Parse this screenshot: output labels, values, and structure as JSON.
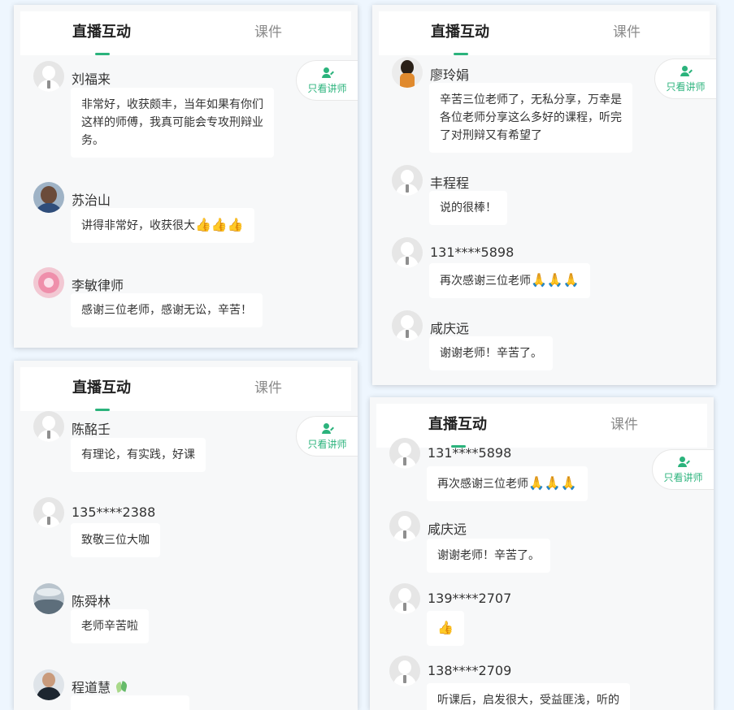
{
  "tabs": {
    "live": "直播互动",
    "courseware": "课件"
  },
  "only_teacher_label": "只看讲师",
  "panels": {
    "p1": {
      "m1": {
        "name": "刘福来",
        "lines": [
          "非常好，收获颇丰，当年如果有你们",
          "这样的师傅，我真可能会专攻刑辩业",
          "务。"
        ]
      },
      "m2": {
        "name": "苏治山",
        "text": "讲得非常好，收获很大",
        "emoji": "👍👍👍"
      },
      "m3": {
        "name": "李敏律师",
        "text": "感谢三位老师，感谢无讼，辛苦！"
      }
    },
    "p2": {
      "m1": {
        "name": "廖玲娟",
        "lines": [
          "辛苦三位老师了，无私分享，万幸是",
          "各位老师分享这么多好的课程，听完",
          "了对刑辩又有希望了"
        ]
      },
      "m2": {
        "name": "丰程程",
        "text": "说的很棒！"
      },
      "m3": {
        "name": "131****5898",
        "text": "再次感谢三位老师",
        "emoji": "🙏🙏🙏"
      },
      "m4": {
        "name": "咸庆远",
        "text": "谢谢老师！辛苦了。"
      }
    },
    "p3": {
      "m1": {
        "name": "陈酩壬",
        "text": "有理论，有实践，好课"
      },
      "m2": {
        "name": "135****2388",
        "text": "致敬三位大咖"
      },
      "m3": {
        "name": "陈舜林",
        "text": "老师辛苦啦"
      },
      "m4": {
        "name": "程道慧"
      }
    },
    "p4": {
      "m1": {
        "name": "131****5898",
        "text": "再次感谢三位老师",
        "emoji": "🙏🙏🙏"
      },
      "m2": {
        "name": "咸庆远",
        "text": "谢谢老师！辛苦了。"
      },
      "m3": {
        "name": "139****2707",
        "emoji": "👍"
      },
      "m4": {
        "name": "138****2709",
        "text": "听课后，启发很大，受益匪浅，听的"
      }
    }
  }
}
